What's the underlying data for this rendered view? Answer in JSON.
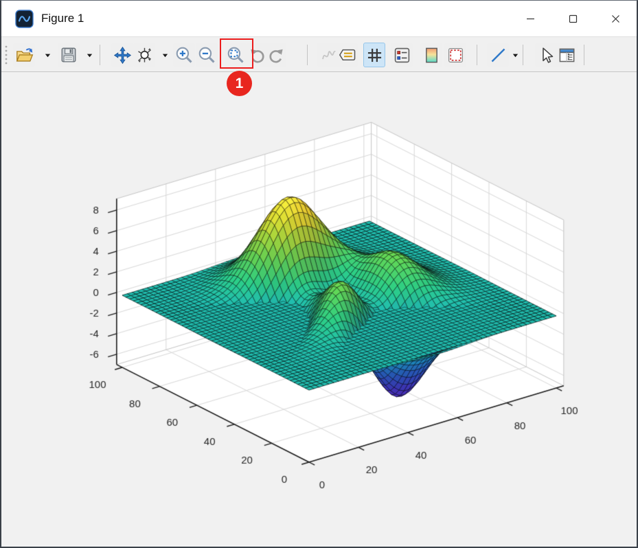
{
  "window": {
    "title": "Figure 1",
    "controls": {
      "minimize": "minimize",
      "maximize": "maximize",
      "close": "close"
    }
  },
  "toolbar": {
    "items": [
      {
        "name": "toolbar-grip",
        "icon": "grip-dots-icon",
        "type": "grip"
      },
      {
        "name": "open-figure-button",
        "icon": "open-folder-icon",
        "type": "button"
      },
      {
        "name": "open-figure-dropdown",
        "icon": "caret-down-icon",
        "type": "caret"
      },
      {
        "name": "save-figure-button",
        "icon": "save-floppy-icon",
        "type": "button"
      },
      {
        "name": "save-figure-dropdown",
        "icon": "caret-down-icon",
        "type": "caret"
      },
      {
        "name": "separator-1",
        "type": "separator"
      },
      {
        "name": "pan-button",
        "icon": "pan-arrows-icon",
        "type": "button"
      },
      {
        "name": "rotate-3d-button",
        "icon": "rotate-3d-icon",
        "type": "button"
      },
      {
        "name": "rotate-3d-dropdown",
        "icon": "caret-down-icon",
        "type": "caret"
      },
      {
        "name": "zoom-in-button",
        "icon": "zoom-in-icon",
        "type": "button"
      },
      {
        "name": "zoom-out-button",
        "icon": "zoom-out-icon",
        "type": "button"
      },
      {
        "name": "zoom-fit-button",
        "icon": "zoom-fit-icon",
        "type": "button",
        "highlighted": true
      },
      {
        "name": "undo-button",
        "icon": "undo-arrow-icon",
        "type": "button"
      },
      {
        "name": "redo-button",
        "icon": "redo-arrow-icon",
        "type": "button"
      },
      {
        "name": "separator-2",
        "type": "separator"
      },
      {
        "name": "data-cursor-button",
        "icon": "curve-squiggle-icon",
        "type": "button",
        "disabled": true
      },
      {
        "name": "annotation-button",
        "icon": "callout-note-icon",
        "type": "button"
      },
      {
        "name": "grid-toggle-button",
        "icon": "grid-hash-icon",
        "type": "button",
        "active": true
      },
      {
        "name": "axes-properties-button",
        "icon": "axes-legend-icon",
        "type": "button"
      },
      {
        "name": "colormap-button",
        "icon": "colormap-gradient-icon",
        "type": "button"
      },
      {
        "name": "canvas-size-button",
        "icon": "dashed-selection-icon",
        "type": "button"
      },
      {
        "name": "separator-3",
        "type": "separator"
      },
      {
        "name": "draw-line-button",
        "icon": "line-tool-icon",
        "type": "button"
      },
      {
        "name": "draw-line-dropdown",
        "icon": "caret-down-icon",
        "type": "caret"
      },
      {
        "name": "separator-4",
        "type": "separator"
      },
      {
        "name": "select-pointer-button",
        "icon": "pointer-arrow-icon",
        "type": "button"
      },
      {
        "name": "properties-panel-button",
        "icon": "properties-window-icon",
        "type": "button"
      },
      {
        "name": "separator-5",
        "type": "separator"
      }
    ]
  },
  "annotation": {
    "badge_label": "1",
    "highlight_color": "#ec1c1c",
    "highlighted_tool": "zoom-fit-button"
  },
  "chart_data": {
    "type": "surface",
    "title": "",
    "xlabel": "",
    "ylabel": "",
    "zlabel": "",
    "surfaces": [
      {
        "name": "peaks-surface",
        "function": "peaks",
        "formula": "z = 3(1-a)^2*exp(-a^2-(b+1)^2) - 10(a/5-a^3-b^5)*exp(-a^2-b^2) - (1/3)exp(-(a+1)^2-b^2), a=6x/100-3, b=6y/100-3",
        "x_range": [
          0,
          100
        ],
        "y_range": [
          0,
          100
        ],
        "z_min": -6.55,
        "z_max": 8.07,
        "grid_divisions": 50,
        "colormap": [
          [
            0.0,
            "#4d2fd1"
          ],
          [
            0.1,
            "#3f3fe3"
          ],
          [
            0.22,
            "#2a68e8"
          ],
          [
            0.33,
            "#1d95da"
          ],
          [
            0.43,
            "#1fb2b4"
          ],
          [
            0.55,
            "#2dc583"
          ],
          [
            0.68,
            "#63cd54"
          ],
          [
            0.8,
            "#a3d43f"
          ],
          [
            0.9,
            "#ddd934"
          ],
          [
            1.0,
            "#fbe33c"
          ]
        ]
      },
      {
        "name": "flat-plane",
        "function": "constant",
        "z": 0,
        "color": "#20b2aa",
        "x_range": [
          0,
          100
        ],
        "y_range": [
          0,
          100
        ],
        "grid_divisions": 50
      }
    ],
    "axes": {
      "x_ticks": [
        0,
        20,
        40,
        60,
        80,
        100
      ],
      "y_ticks": [
        0,
        20,
        40,
        60,
        80,
        100
      ],
      "z_ticks": [
        -6,
        -4,
        -2,
        0,
        2,
        4,
        6,
        8
      ],
      "xlim": [
        0,
        103
      ],
      "ylim": [
        0,
        103
      ],
      "zlim": [
        -7,
        9.1
      ],
      "grid": true,
      "wall_color": "#ffffff",
      "grid_color": "#d7d7d7",
      "axis_color": "#1a1a1a",
      "tick_label_color": "#262626"
    },
    "view": {
      "azimuth": -37.5,
      "elevation": 30,
      "projection": "orthographic"
    },
    "legend": null
  }
}
